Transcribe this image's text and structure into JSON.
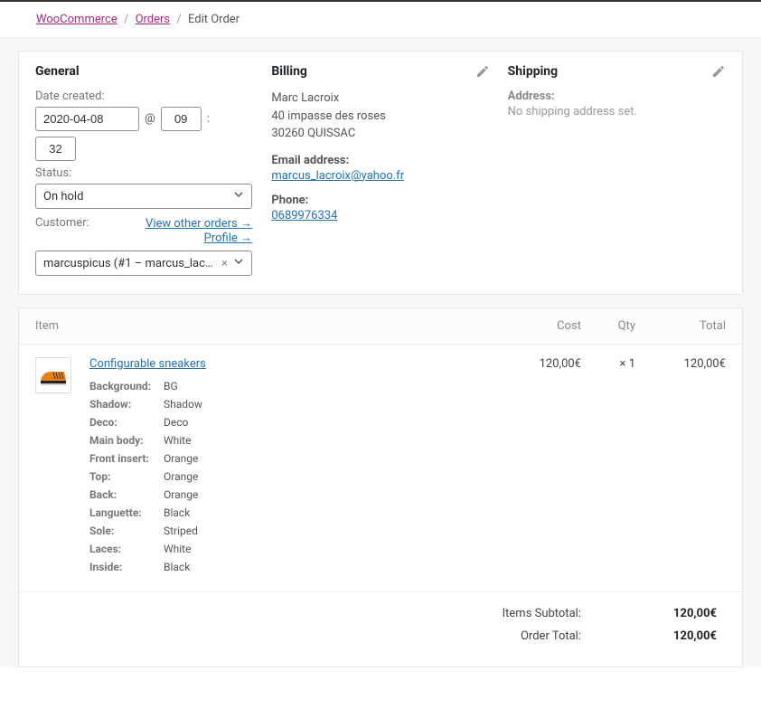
{
  "breadcrumb": {
    "woocommerce": "WooCommerce",
    "orders": "Orders",
    "edit_order": "Edit Order"
  },
  "general": {
    "heading": "General",
    "date_created_label": "Date created:",
    "date": "2020-04-08",
    "at_symbol": "@",
    "hour": "09",
    "colon": ":",
    "minute": "32",
    "status_label": "Status:",
    "status_value": "On hold",
    "customer_label": "Customer:",
    "view_other_orders": "View other orders →",
    "profile": "Profile →",
    "customer_value": "marcuspicus (#1 – marcus_lacro…"
  },
  "billing": {
    "heading": "Billing",
    "name": "Marc Lacroix",
    "street": "40 impasse des roses",
    "city": "30260 QUISSAC",
    "email_label": "Email address:",
    "email": "marcus_lacroix@yahoo.fr",
    "phone_label": "Phone:",
    "phone": "0689976334"
  },
  "shipping": {
    "heading": "Shipping",
    "address_label": "Address:",
    "no_address": "No shipping address set."
  },
  "items": {
    "header_item": "Item",
    "header_cost": "Cost",
    "header_qty": "Qty",
    "header_total": "Total",
    "product_name": "Configurable sneakers",
    "cost": "120,00€",
    "qty_prefix": "×",
    "qty": "1",
    "total": "120,00€",
    "meta": [
      {
        "key": "Background:",
        "val": "BG"
      },
      {
        "key": "Shadow:",
        "val": "Shadow"
      },
      {
        "key": "Deco:",
        "val": "Deco"
      },
      {
        "key": "Main body:",
        "val": "White"
      },
      {
        "key": "Front insert:",
        "val": "Orange"
      },
      {
        "key": "Top:",
        "val": "Orange"
      },
      {
        "key": "Back:",
        "val": "Orange"
      },
      {
        "key": "Languette:",
        "val": "Black"
      },
      {
        "key": "Sole:",
        "val": "Striped"
      },
      {
        "key": "Laces:",
        "val": "White"
      },
      {
        "key": "Inside:",
        "val": "Black"
      }
    ]
  },
  "totals": {
    "subtotal_label": "Items Subtotal:",
    "subtotal_value": "120,00€",
    "order_total_label": "Order Total:",
    "order_total_value": "120,00€"
  }
}
